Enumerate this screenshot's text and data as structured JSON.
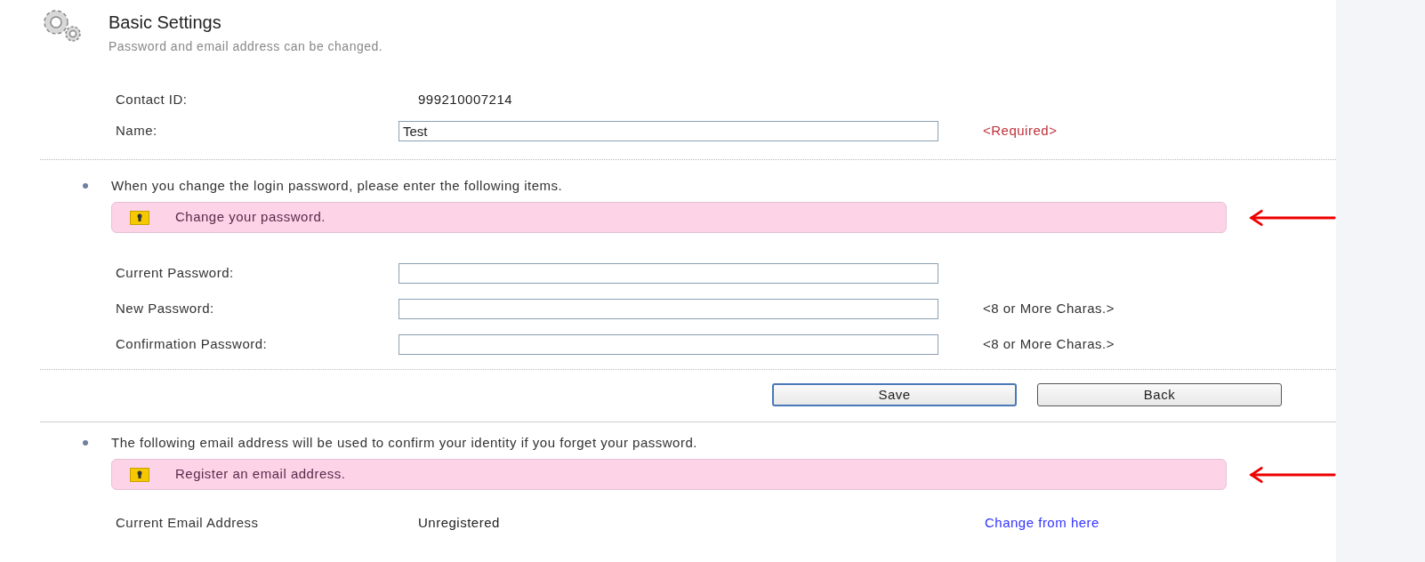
{
  "header": {
    "title": "Basic Settings",
    "subtitle": "Password and email address can be changed."
  },
  "profile": [
    {
      "label": "Contact ID:",
      "kind": "text",
      "value": "999210007214"
    },
    {
      "label": "Name:",
      "kind": "input",
      "value": "Test",
      "hint": "<Required>",
      "color": "#c0303a"
    }
  ],
  "password_section": {
    "note": "When you change the login password, please enter the following items.",
    "banner": "Change your password.",
    "fields": [
      {
        "label": "Current Password:",
        "kind": "input"
      },
      {
        "label": "New Password:",
        "kind": "input",
        "hint": "<8 or More Charas.>",
        "color": "#333333"
      },
      {
        "label": "Confirmation Password:",
        "kind": "input",
        "hint": "<8 or More Charas.>",
        "color": "#333333"
      }
    ]
  },
  "buttons": [
    {
      "label": "Save",
      "selected": true
    },
    {
      "label": "Back",
      "selected": false
    }
  ],
  "email_section": {
    "note": "The following email address will be used to confirm your identity if you forget your password.",
    "banner": "Register an email address.",
    "fields": [
      {
        "label": "Current Email Address",
        "kind": "text",
        "value": "Unregistered",
        "link": "Change from here"
      }
    ]
  }
}
